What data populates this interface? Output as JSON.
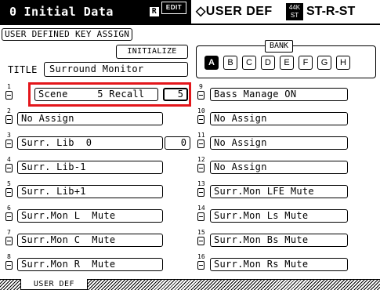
{
  "header": {
    "scene_number": "0",
    "scene_name": "Initial Data",
    "r_badge": "R",
    "edit_badge": "EDIT",
    "function_title": "◇USER DEF",
    "fs_badge_top": "44K",
    "fs_badge_bottom": "ST",
    "output_mode": "ST-R-ST"
  },
  "page": {
    "label": "USER DEFINED KEY ASSIGN",
    "initialize_label": "INITIALIZE",
    "title_label": "TITLE",
    "title_value": "Surround Monitor"
  },
  "bank": {
    "label": "BANK",
    "selected": "A",
    "buttons": [
      "A",
      "B",
      "C",
      "D",
      "E",
      "F",
      "G",
      "H"
    ]
  },
  "keys": [
    {
      "num": "1",
      "label": "Scene     5 Recall",
      "value": "5"
    },
    {
      "num": "2",
      "label": "No Assign"
    },
    {
      "num": "3",
      "label": "Surr. Lib  0",
      "value": "0"
    },
    {
      "num": "4",
      "label": "Surr. Lib-1"
    },
    {
      "num": "5",
      "label": "Surr. Lib+1"
    },
    {
      "num": "6",
      "label": "Surr.Mon L  Mute"
    },
    {
      "num": "7",
      "label": "Surr.Mon C  Mute"
    },
    {
      "num": "8",
      "label": "Surr.Mon R  Mute"
    },
    {
      "num": "9",
      "label": "Bass Manage ON"
    },
    {
      "num": "10",
      "label": "No Assign"
    },
    {
      "num": "11",
      "label": "No Assign"
    },
    {
      "num": "12",
      "label": "No Assign"
    },
    {
      "num": "13",
      "label": "Surr.Mon LFE Mute"
    },
    {
      "num": "14",
      "label": "Surr.Mon Ls Mute"
    },
    {
      "num": "15",
      "label": "Surr.Mon Bs Mute"
    },
    {
      "num": "16",
      "label": "Surr.Mon Rs Mute"
    }
  ],
  "footer": {
    "tab_label": "USER DEF"
  },
  "colors": {
    "highlight": "#e3161b"
  }
}
